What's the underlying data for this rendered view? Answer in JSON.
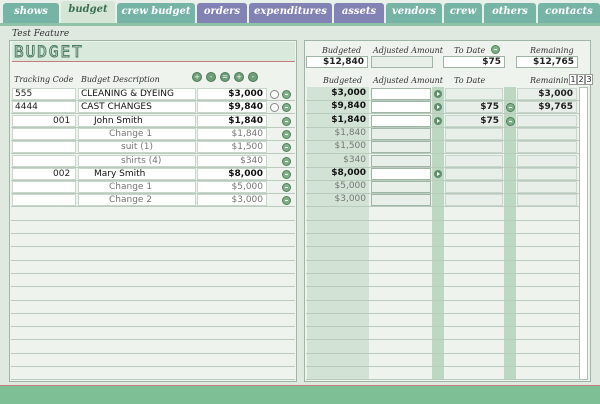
{
  "tabs": [
    {
      "label": "shows",
      "style": "green"
    },
    {
      "label": "budget",
      "style": "active"
    },
    {
      "label": "crew budget",
      "style": "green"
    },
    {
      "label": "orders",
      "style": "purple"
    },
    {
      "label": "expenditures",
      "style": "purple"
    },
    {
      "label": "assets",
      "style": "purple"
    },
    {
      "label": "vendors",
      "style": "green"
    },
    {
      "label": "crew",
      "style": "green"
    },
    {
      "label": "others",
      "style": "green"
    },
    {
      "label": "contacts",
      "style": "green"
    }
  ],
  "page": {
    "feature_title": "Test Feature",
    "logo_text": "BUDGET",
    "left_headers": {
      "tracking_code": "Tracking Code",
      "budget_description": "Budget Description"
    },
    "summary_headers": {
      "budgeted": "Budgeted",
      "adjusted": "Adjusted Amount",
      "to_date": "To Date",
      "remaining": "Remaining"
    },
    "summary_values": {
      "budgeted": "$12,840",
      "adjusted": "",
      "to_date": "$75",
      "remaining": "$12,765"
    },
    "right_headers": {
      "budgeted": "Budgeted",
      "adjusted": "Adjusted Amount",
      "to_date": "To Date",
      "remaining": "Remaining"
    },
    "page_numbers": [
      "1",
      "2",
      "3"
    ]
  },
  "rows": [
    {
      "code": "555",
      "desc": "CLEANING & DYEING",
      "amount": "$3,000",
      "indent": 0,
      "dim": false,
      "ring": true,
      "budgeted": "$3,000",
      "adjusted": "",
      "arrow": true,
      "to_date": "",
      "to_date_btn": false,
      "remaining": "$3,000"
    },
    {
      "code": "4444",
      "desc": "CAST CHANGES",
      "amount": "$9,840",
      "indent": 0,
      "dim": false,
      "ring": true,
      "budgeted": "$9,840",
      "adjusted": "",
      "arrow": true,
      "to_date": "$75",
      "to_date_btn": true,
      "remaining": "$9,765"
    },
    {
      "code": "001",
      "desc": "John Smith",
      "amount": "$1,840",
      "indent": 1,
      "dim": false,
      "ring": false,
      "budgeted": "$1,840",
      "adjusted": "",
      "arrow": true,
      "to_date": "$75",
      "to_date_btn": true,
      "remaining": ""
    },
    {
      "code": "",
      "desc": "Change 1",
      "amount": "$1,840",
      "indent": 2,
      "dim": true,
      "ring": false,
      "budgeted": "$1,840",
      "adjusted": "",
      "arrow": false,
      "to_date": "",
      "to_date_btn": false,
      "remaining": ""
    },
    {
      "code": "",
      "desc": "suit (1)",
      "amount": "$1,500",
      "indent": 3,
      "dim": true,
      "ring": false,
      "budgeted": "$1,500",
      "adjusted": "",
      "arrow": false,
      "to_date": "",
      "to_date_btn": false,
      "remaining": ""
    },
    {
      "code": "",
      "desc": "shirts (4)",
      "amount": "$340",
      "indent": 3,
      "dim": true,
      "ring": false,
      "budgeted": "$340",
      "adjusted": "",
      "arrow": false,
      "to_date": "",
      "to_date_btn": false,
      "remaining": ""
    },
    {
      "code": "002",
      "desc": "Mary Smith",
      "amount": "$8,000",
      "indent": 1,
      "dim": false,
      "ring": false,
      "budgeted": "$8,000",
      "adjusted": "",
      "arrow": true,
      "to_date": "",
      "to_date_btn": false,
      "remaining": ""
    },
    {
      "code": "",
      "desc": "Change 1",
      "amount": "$5,000",
      "indent": 2,
      "dim": true,
      "ring": false,
      "budgeted": "$5,000",
      "adjusted": "",
      "arrow": false,
      "to_date": "",
      "to_date_btn": false,
      "remaining": ""
    },
    {
      "code": "",
      "desc": "Change 2",
      "amount": "$3,000",
      "indent": 2,
      "dim": true,
      "ring": false,
      "budgeted": "$3,000",
      "adjusted": "",
      "arrow": false,
      "to_date": "",
      "to_date_btn": false,
      "remaining": ""
    }
  ],
  "colors": {
    "tab_green": "#76b4a5",
    "tab_purple": "#8282b4",
    "accent": "#7ebf95",
    "divider_red": "#c47b7b"
  }
}
